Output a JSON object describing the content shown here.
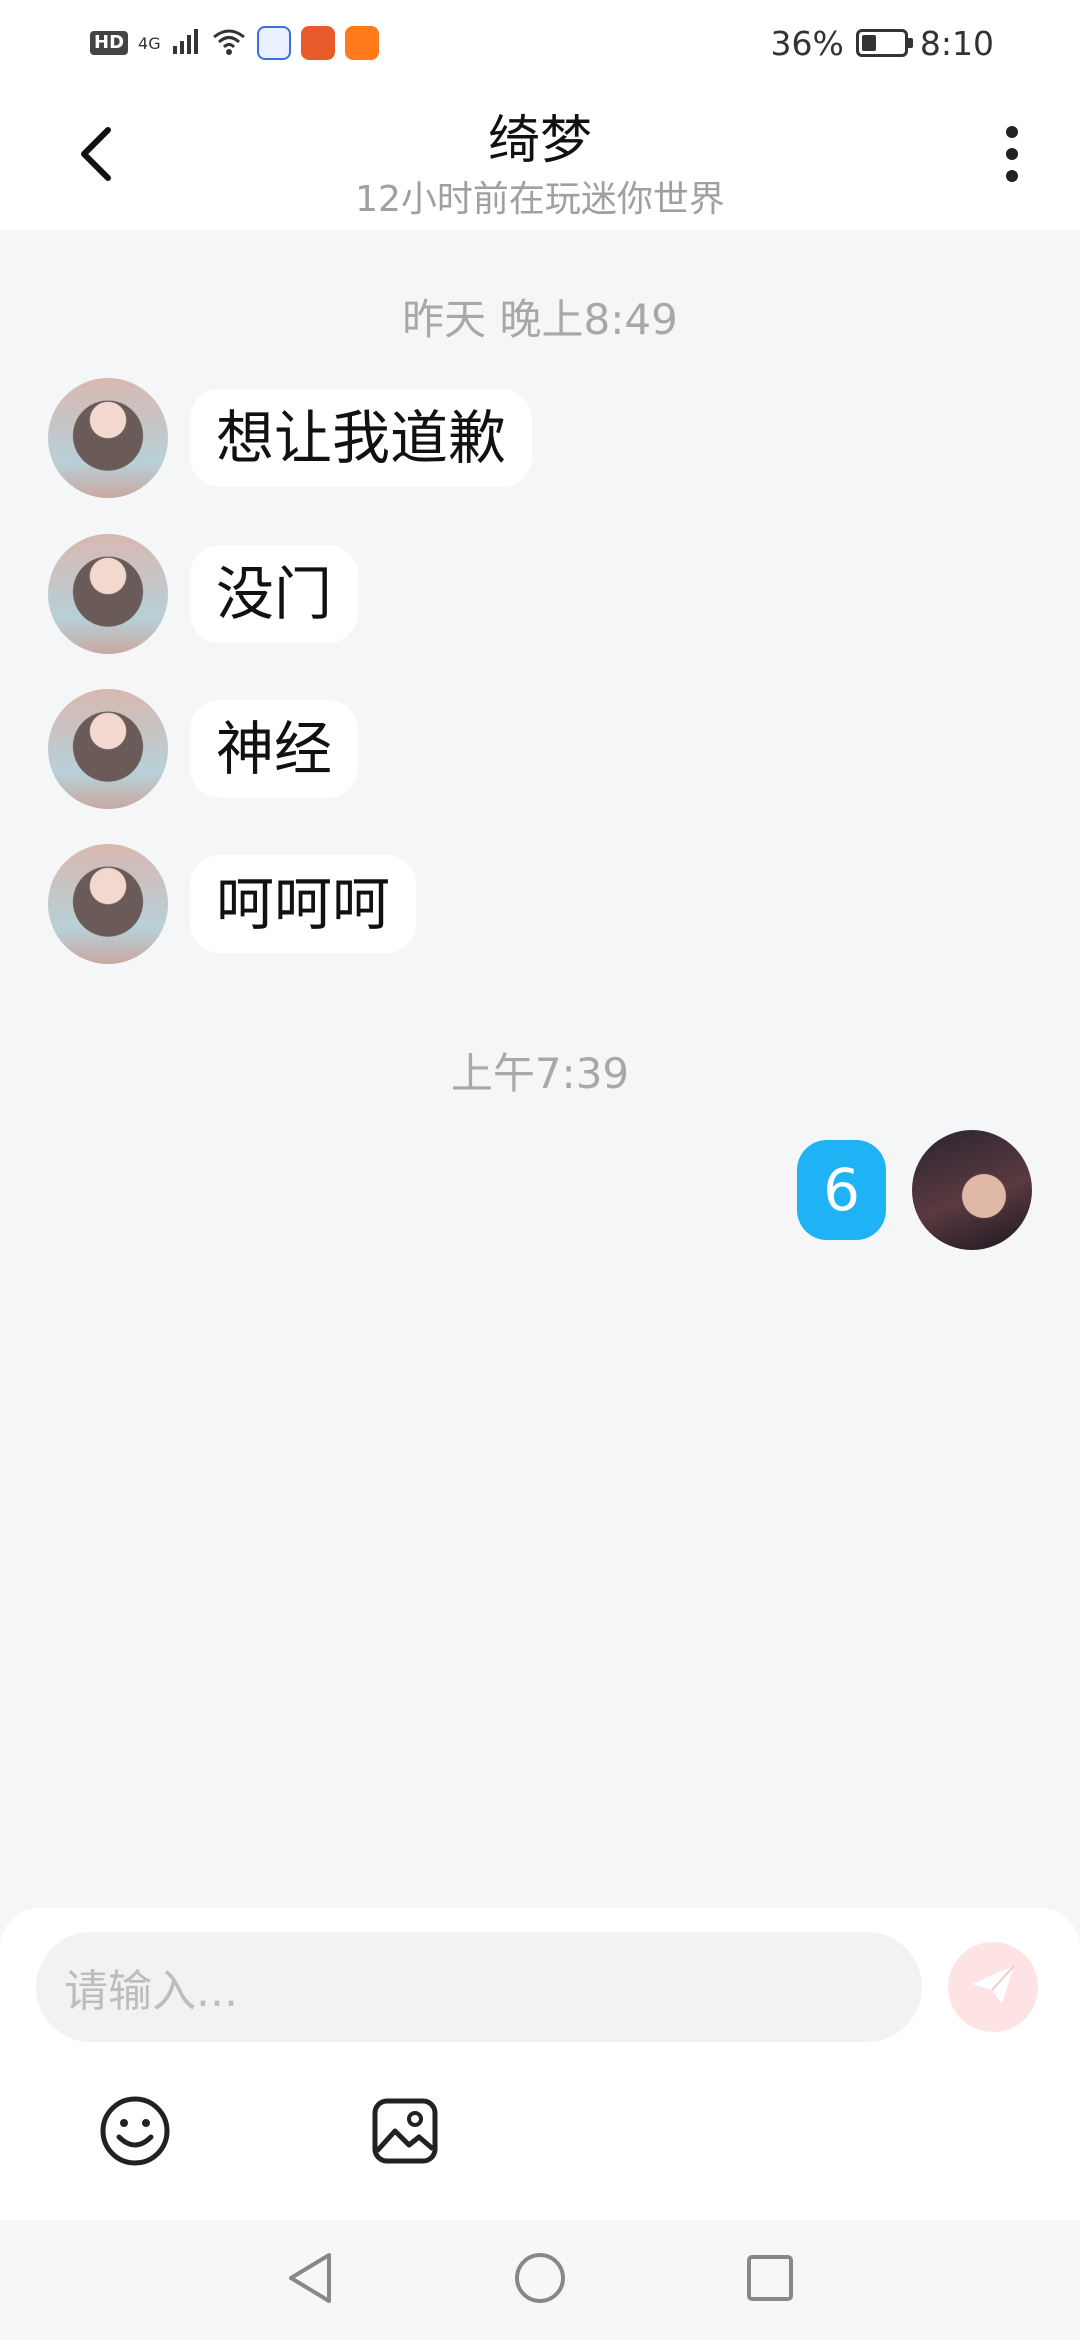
{
  "status_bar": {
    "network": "4G",
    "hd": "HD",
    "battery_percent": "36%",
    "battery_level": 0.36,
    "time": "8:10"
  },
  "header": {
    "title": "绮梦",
    "subtitle": "12小时前在玩迷你世界"
  },
  "chat": {
    "time_1": "昨天 晚上8:49",
    "received_messages": [
      "想让我道歉",
      "没门",
      "神经",
      "呵呵呵"
    ],
    "time_2": "上午7:39",
    "sent_message": "6"
  },
  "input": {
    "placeholder": "请输入..."
  },
  "icons": {
    "back": "chevron-left-icon",
    "more": "more-vertical-icon",
    "send": "paper-plane-icon",
    "emoji": "smiley-icon",
    "image": "image-icon",
    "nav_back": "triangle-back-icon",
    "nav_home": "circle-home-icon",
    "nav_recent": "square-recent-icon"
  },
  "colors": {
    "sent_bubble": "#1fb3f5",
    "send_button": "#fde3e3",
    "background": "#f5f6f8"
  }
}
